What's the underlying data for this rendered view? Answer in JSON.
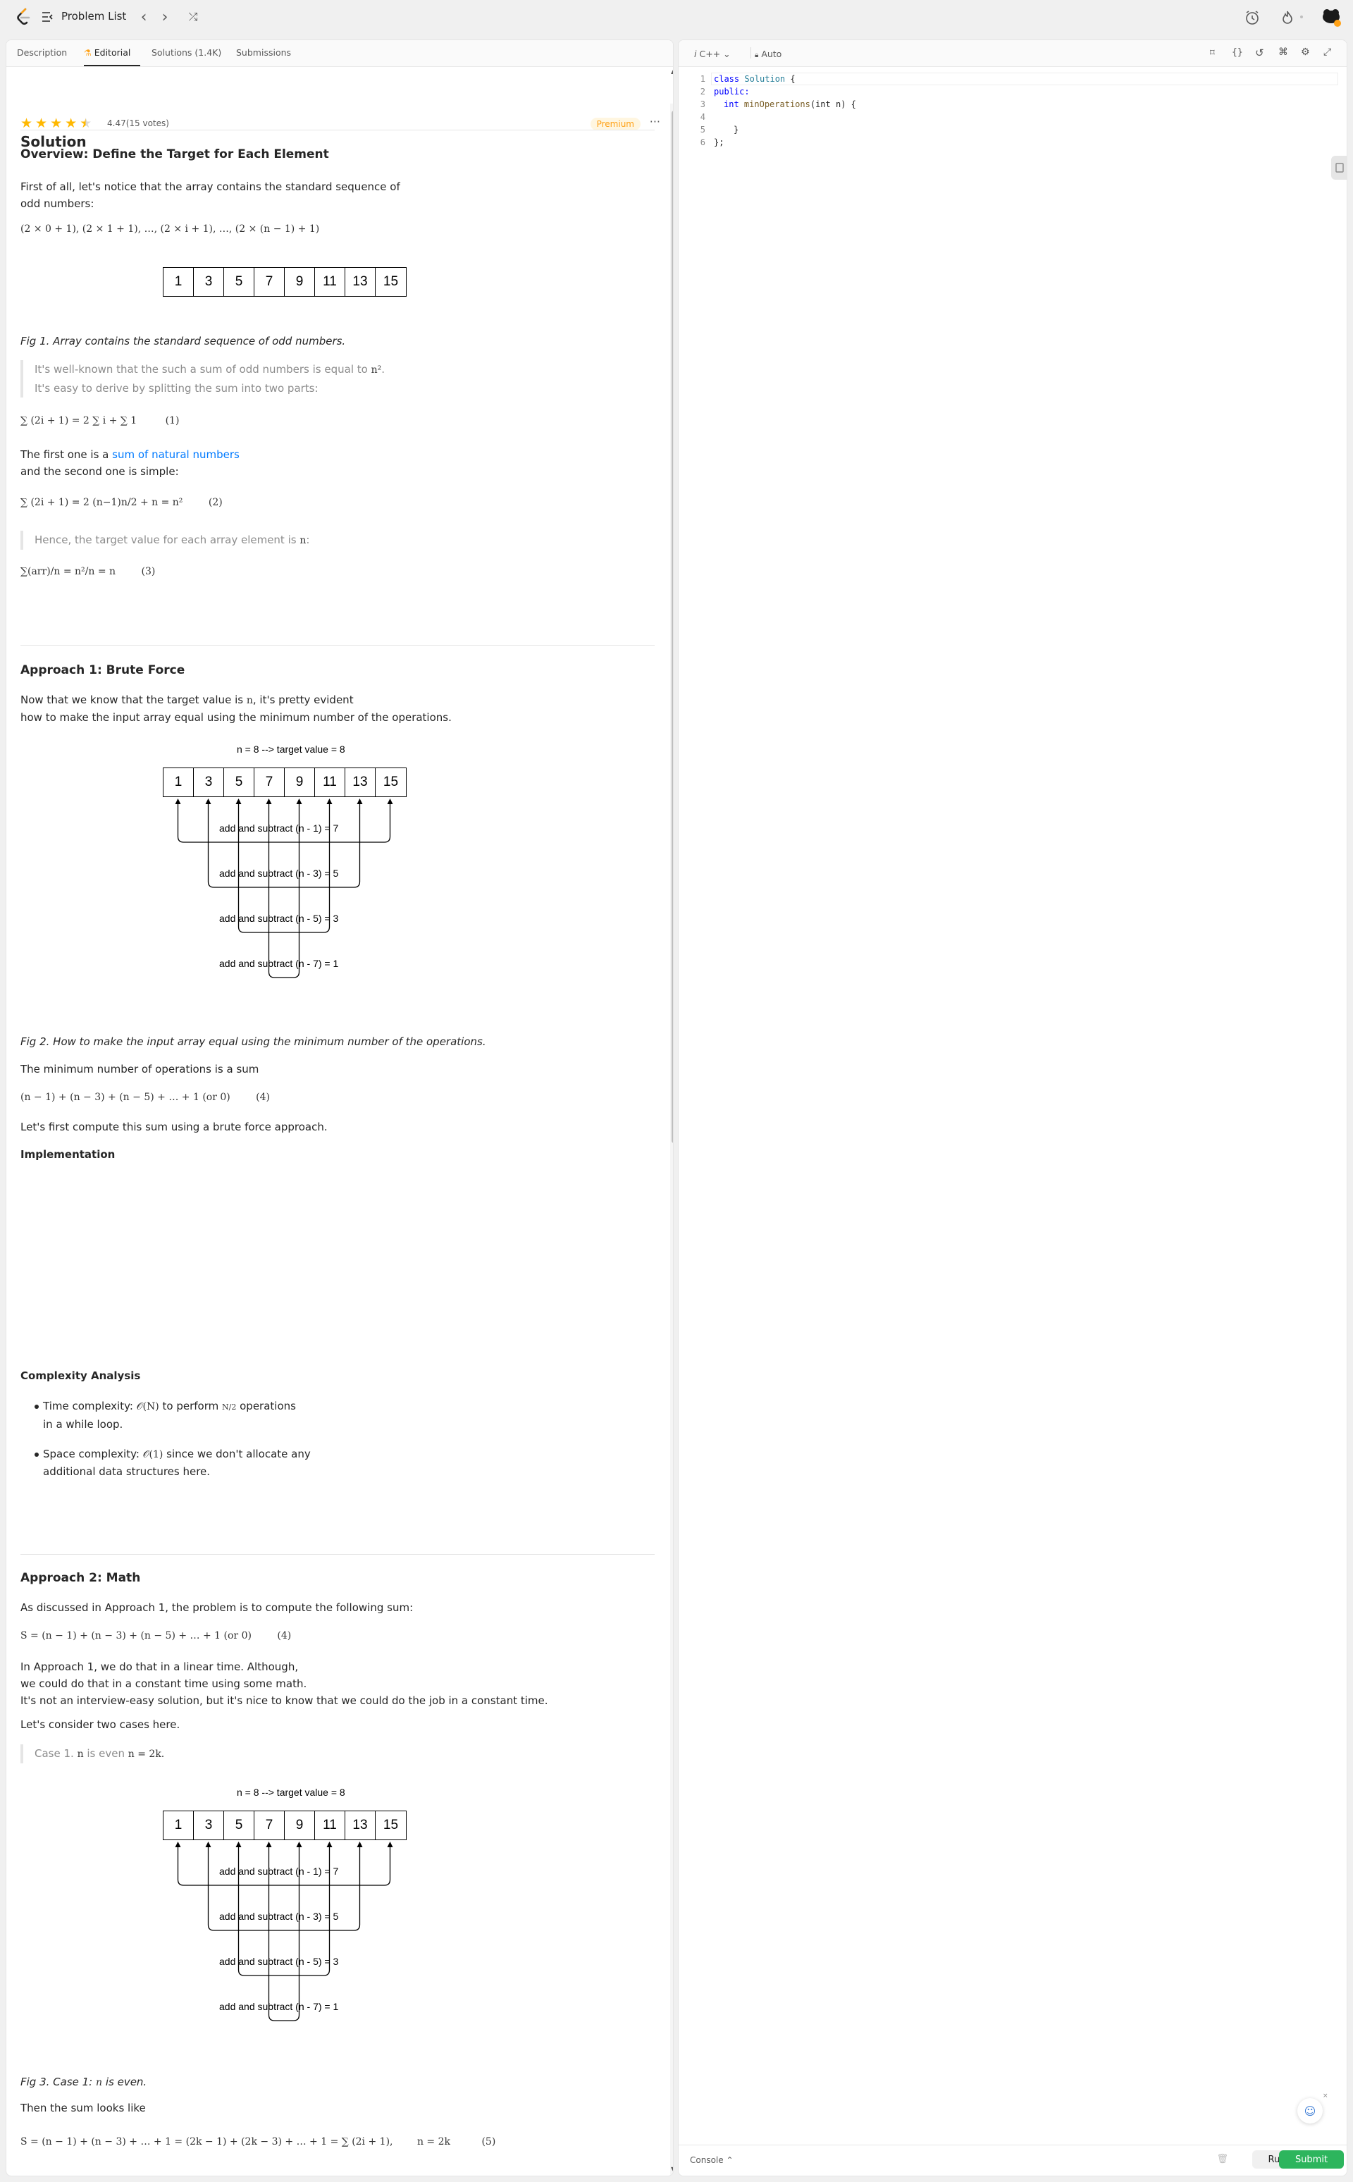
{
  "topbar": {
    "problem_list": "Problem List",
    "prev": "‹",
    "next": "›",
    "shuffle": "⤮"
  },
  "tabs": {
    "description": "Description",
    "editorial": "Editorial",
    "solutions": "Solutions (1.4K)",
    "submissions": "Submissions"
  },
  "rating": {
    "stars": 4.47,
    "text": "4.47",
    "votes": "(15 votes)",
    "premium": "Premium",
    "more": "···"
  },
  "article": {
    "title": "Solution",
    "overview_heading": "Overview: Define the Target for Each Element",
    "overview_p1a": "First of all, let's notice that the array contains the standard sequence of",
    "overview_p1b": "odd numbers:",
    "formula_seq": "(2 × 0 + 1), (2 × 1 + 1), …, (2 × i + 1), …, (2 × (n − 1) + 1)",
    "array1": [
      "1",
      "3",
      "5",
      "7",
      "9",
      "11",
      "13",
      "15"
    ],
    "fig1": "Fig 1. Array contains the standard sequence of odd numbers.",
    "quote1a": "It's well-known that the such a sum of odd numbers is equal to",
    "quote1a_math": "n²",
    "quote1b": "It's easy to derive by splitting the sum into two parts:",
    "eq1": "∑ (2i + 1) = 2 ∑ i + ∑ 1",
    "eq1_num": "(1)",
    "p_first_a": "The first one is a",
    "p_first_link": "sum of natural numbers",
    "p_first_b": "and the second one is simple:",
    "eq2": "∑ (2i + 1) = 2 (n−1)n/2 + n = n²",
    "eq2_num": "(2)",
    "quote2": "Hence, the target value for each array element is",
    "quote2_math": "n",
    "eq3": "∑(arr)/n = n²/n = n",
    "eq3_num": "(3)",
    "approach1_heading": "Approach 1: Brute Force",
    "a1_p1a": "Now that we know that the target value is",
    "a1_p1_math": "n",
    "a1_p1b": ", it's pretty evident",
    "a1_p2": "how to make the input array equal using the minimum number of the operations.",
    "diagram_title": "n = 8 --> target value = 8",
    "diagram_labels": [
      "add and subtract (n - 1) = 7",
      "add and subtract (n - 3) = 5",
      "add and subtract (n - 5) = 3",
      "add and subtract (n - 7) = 1"
    ],
    "fig2": "Fig 2. How to make the input array equal using the minimum number of the operations.",
    "a1_p3": "The minimum number of operations is a sum",
    "eq4": "(n − 1) + (n − 3) + (n − 5) + … + 1 (or 0)",
    "eq4_num": "(4)",
    "a1_p4": "Let's first compute this sum using a brute force approach.",
    "impl_heading": "Implementation",
    "complexity_heading": "Complexity Analysis",
    "time_a": "Time complexity:",
    "time_math": "𝒪(N)",
    "time_b": "to perform",
    "time_frac": "N/2",
    "time_c": "operations",
    "time_d": "in a while loop.",
    "space_a": "Space complexity:",
    "space_math": "𝒪(1)",
    "space_b": "since we don't allocate any",
    "space_c": "additional data structures here.",
    "approach2_heading": "Approach 2: Math",
    "a2_p1": "As discussed in Approach 1, the problem is to compute the following sum:",
    "eq4b": "S = (n − 1) + (n − 3) + (n − 5) + … + 1 (or 0)",
    "eq4b_num": "(4)",
    "a2_p2a": "In Approach 1, we do that in a linear time. Although,",
    "a2_p2b": "we could do that in a constant time using some math.",
    "a2_p2c": "It's not an interview-easy solution, but it's nice to know that we could do the job in a constant time.",
    "a2_p3": "Let's consider two cases here.",
    "quote3a": "Case 1.",
    "quote3_math1": "n",
    "quote3b": "is even",
    "quote3_math2": "n = 2k.",
    "fig3a": "Fig 3. Case 1:",
    "fig3_math": "n",
    "fig3b": "is even.",
    "a2_p4": "Then the sum looks like",
    "eq5": "S = (n − 1) + (n − 3) + … + 1 = (2k − 1) + (2k − 3) + … + 1 = ∑ (2i + 1),",
    "eq5_cond": "n = 2k",
    "eq5_num": "(5)"
  },
  "editor": {
    "language": "C++",
    "mode": "Auto",
    "line_numbers": [
      "1",
      "2",
      "3",
      "4",
      "5",
      "6"
    ],
    "code": {
      "l1_kw": "class",
      "l1_name": "Solution",
      "l1_end": " {",
      "l2": "public:",
      "l3_type": "int",
      "l3_fn": "minOperations",
      "l3_args": "(int n) {",
      "l5": "}",
      "l6": "};"
    },
    "console": "Console",
    "run": "Run",
    "submit": "Submit"
  },
  "colors": {
    "accent": "#ffa116",
    "submit": "#2db55d",
    "link": "#007aff",
    "star": "#ffb800"
  }
}
